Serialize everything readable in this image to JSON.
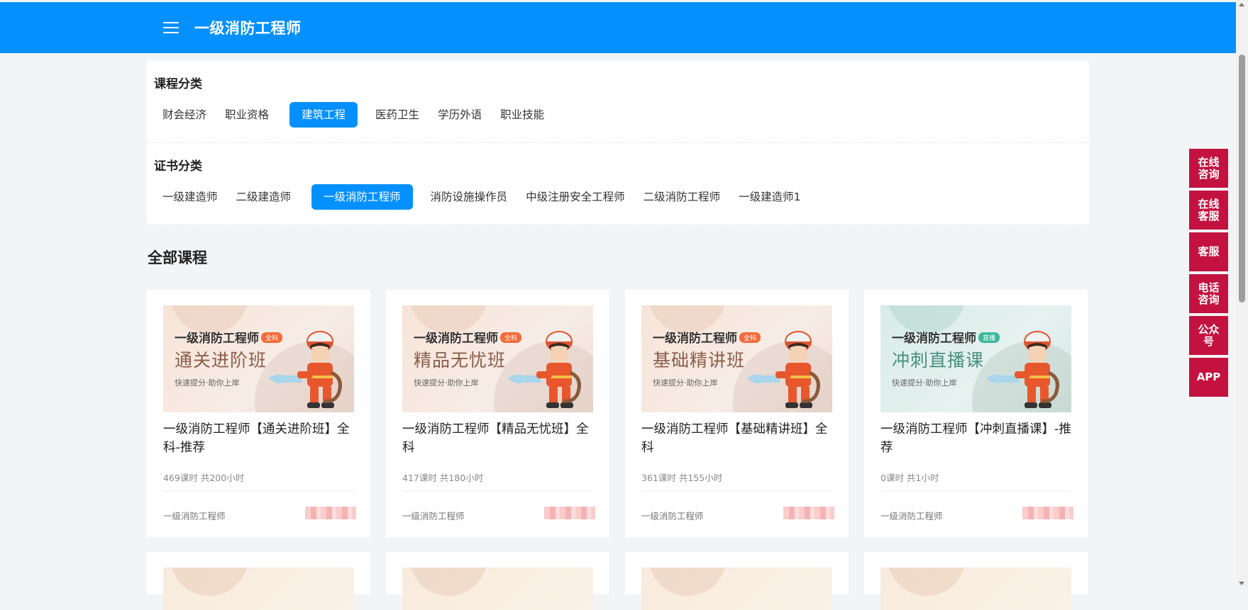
{
  "header": {
    "title": "一级消防工程师",
    "menu_icon": "hamburger-menu-icon"
  },
  "filters": {
    "course_category": {
      "title": "课程分类",
      "items": [
        "财会经济",
        "职业资格",
        "建筑工程",
        "医药卫生",
        "学历外语",
        "职业技能"
      ],
      "active": "建筑工程"
    },
    "certificate_category": {
      "title": "证书分类",
      "items": [
        "一级建造师",
        "二级建造师",
        "一级消防工程师",
        "消防设施操作员",
        "中级注册安全工程师",
        "二级消防工程师",
        "一级建造师1"
      ],
      "active": "一级消防工程师"
    }
  },
  "section": {
    "title": "全部课程"
  },
  "courses": [
    {
      "thumb_brand": "一级消防工程师",
      "thumb_tag": "全科",
      "thumb_name": "通关进阶班",
      "thumb_slogan": "快速提分·助你上岸",
      "title": "一级消防工程师【通关进阶班】全科-推荐",
      "meta": "469课时 共200小时",
      "cert": "一级消防工程师"
    },
    {
      "thumb_brand": "一级消防工程师",
      "thumb_tag": "全科",
      "thumb_name": "精品无忧班",
      "thumb_slogan": "快速提分·助你上岸",
      "title": "一级消防工程师【精品无忧班】全科",
      "meta": "417课时 共180小时",
      "cert": "一级消防工程师"
    },
    {
      "thumb_brand": "一级消防工程师",
      "thumb_tag": "全科",
      "thumb_name": "基础精讲班",
      "thumb_slogan": "快速提分·助你上岸",
      "title": "一级消防工程师【基础精讲班】全科",
      "meta": "361课时 共155小时",
      "cert": "一级消防工程师"
    },
    {
      "thumb_brand": "一级消防工程师",
      "thumb_tag": "直播",
      "thumb_name": "冲刺直播课",
      "thumb_slogan": "快速提分·助你上岸",
      "title": "一级消防工程师【冲刺直播课】-推荐",
      "meta": "0课时 共1小时",
      "cert": "一级消防工程师"
    }
  ],
  "side_buttons": [
    "在线咨询",
    "在线客服",
    "客服",
    "电话咨询",
    "公众号",
    "APP"
  ],
  "colors": {
    "brand_blue": "#0590ff",
    "side_red": "#c3123f",
    "page_bg": "#f3f4f6"
  }
}
